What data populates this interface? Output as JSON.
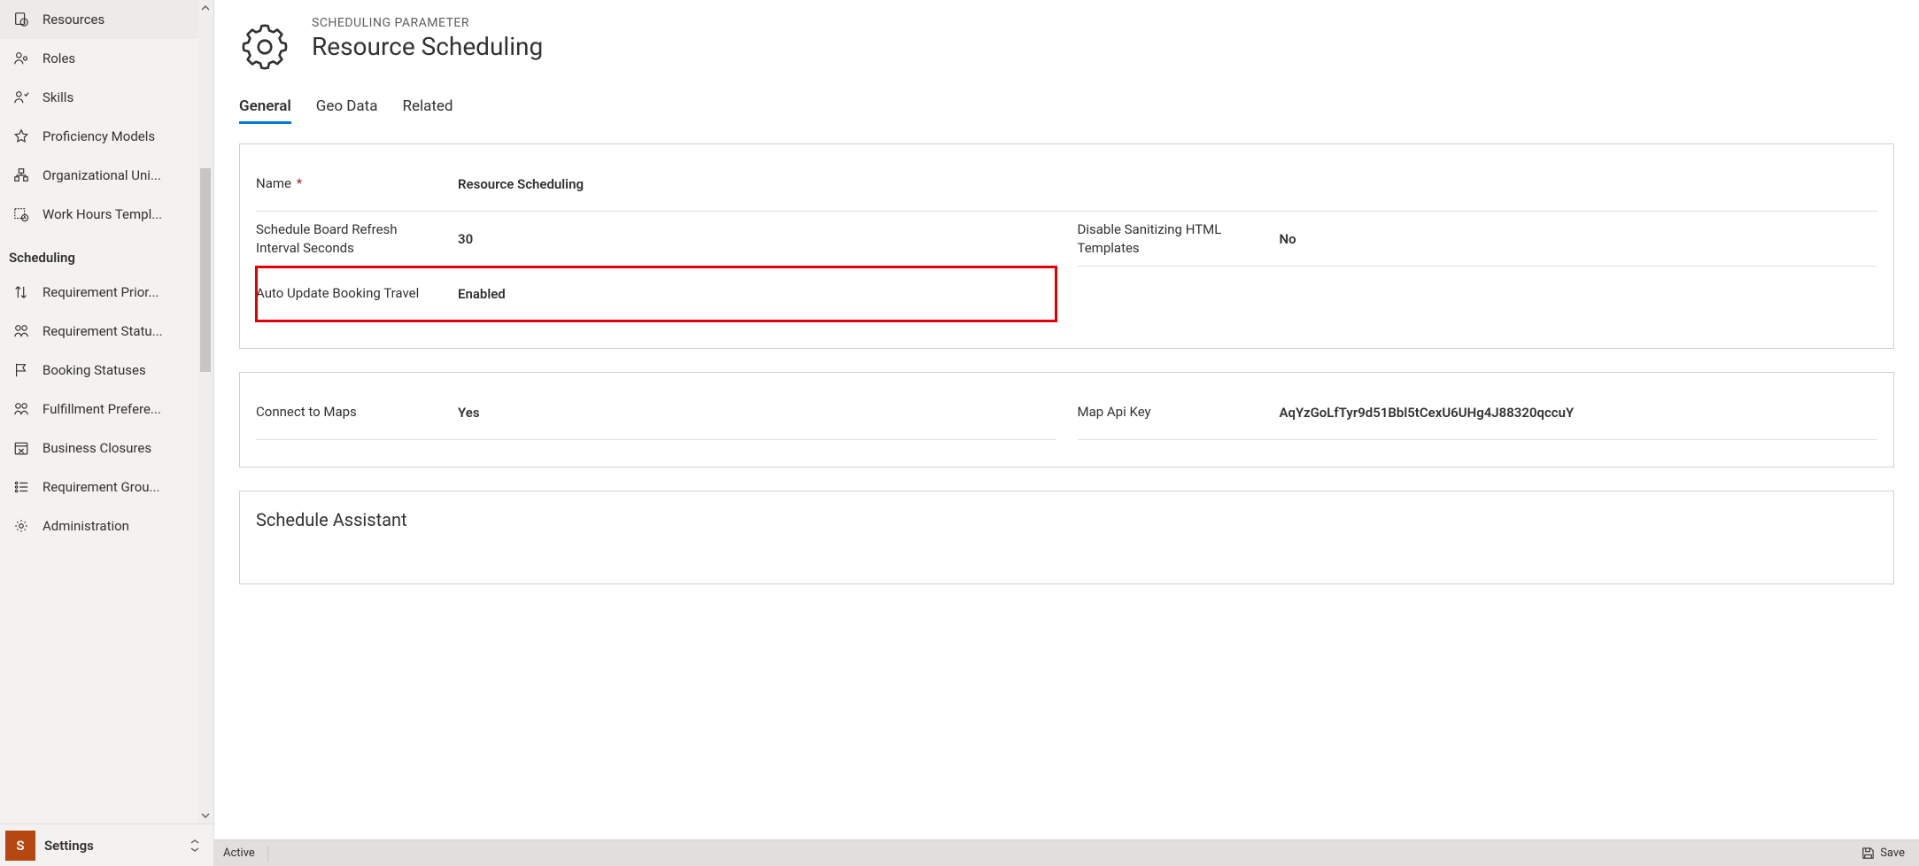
{
  "sidebar": {
    "items": [
      {
        "label": "Resources"
      },
      {
        "label": "Roles"
      },
      {
        "label": "Skills"
      },
      {
        "label": "Proficiency Models"
      },
      {
        "label": "Organizational Uni..."
      },
      {
        "label": "Work Hours Templ..."
      }
    ],
    "scheduling_header": "Scheduling",
    "scheduling_items": [
      {
        "label": "Requirement Prior..."
      },
      {
        "label": "Requirement Statu..."
      },
      {
        "label": "Booking Statuses"
      },
      {
        "label": "Fulfillment Prefere..."
      },
      {
        "label": "Business Closures"
      },
      {
        "label": "Requirement Grou..."
      },
      {
        "label": "Administration"
      }
    ]
  },
  "area_switcher": {
    "letter": "S",
    "label": "Settings"
  },
  "header": {
    "eyebrow": "SCHEDULING PARAMETER",
    "title": "Resource Scheduling"
  },
  "tabs": [
    {
      "label": "General",
      "active": true
    },
    {
      "label": "Geo Data",
      "active": false
    },
    {
      "label": "Related",
      "active": false
    }
  ],
  "section1": {
    "name_label": "Name",
    "name_value": "Resource Scheduling",
    "refresh_label": "Schedule Board Refresh Interval Seconds",
    "refresh_value": "30",
    "disable_sanitize_label": "Disable Sanitizing HTML Templates",
    "disable_sanitize_value": "No",
    "auto_update_label": "Auto Update Booking Travel",
    "auto_update_value": "Enabled"
  },
  "section2": {
    "connect_label": "Connect to Maps",
    "connect_value": "Yes",
    "apikey_label": "Map Api Key",
    "apikey_value": "AqYzGoLfTyr9d51Bbl5tCexU6UHg4J88320qccuY"
  },
  "section3": {
    "title": "Schedule Assistant"
  },
  "statusbar": {
    "state": "Active",
    "save": "Save"
  }
}
